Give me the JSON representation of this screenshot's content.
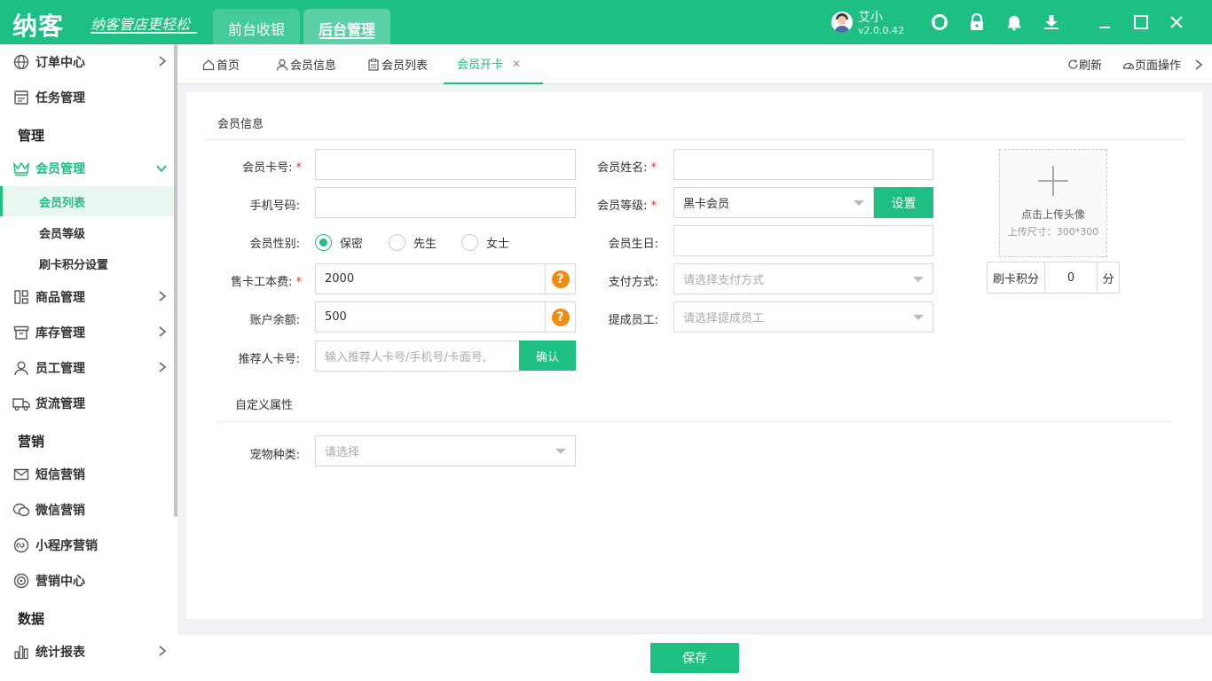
{
  "app": {
    "logo": "纳客",
    "slogan": "纳客管店更轻松",
    "nav": [
      "前台收银",
      "后台管理"
    ],
    "user_name": "艾小",
    "version": "v2.0.0.42",
    "accent_color": "#1dbf83"
  },
  "sidebar": {
    "items": [
      {
        "label": "订单中心",
        "icon": "globe-icon"
      },
      {
        "label": "任务管理",
        "icon": "task-icon"
      },
      {
        "label": "会员管理",
        "icon": "crown-icon"
      },
      {
        "label": "商品管理",
        "icon": "goods-icon"
      },
      {
        "label": "库存管理",
        "icon": "box-icon"
      },
      {
        "label": "员工管理",
        "icon": "user-icon"
      },
      {
        "label": "货流管理",
        "icon": "truck-icon"
      },
      {
        "label": "短信营销",
        "icon": "mail-icon"
      },
      {
        "label": "微信营销",
        "icon": "wechat-icon"
      },
      {
        "label": "小程序营销",
        "icon": "miniprogram-icon"
      },
      {
        "label": "营销中心",
        "icon": "target-icon"
      },
      {
        "label": "统计报表",
        "icon": "chart-icon"
      }
    ],
    "sections": [
      "管理",
      "营销",
      "数据"
    ],
    "sub_items": [
      "会员列表",
      "会员等级",
      "刷卡积分设置"
    ]
  },
  "tabs": {
    "items": [
      "首页",
      "会员信息",
      "会员列表",
      "会员开卡"
    ],
    "refresh": "刷新",
    "page_ops": "页面操作"
  },
  "form": {
    "section_member": "会员信息",
    "section_custom": "自定义属性",
    "labels": {
      "card_no": "会员卡号:",
      "name": "会员姓名:",
      "phone": "手机号码:",
      "level": "会员等级:",
      "gender": "会员性别:",
      "birthday": "会员生日:",
      "card_fee": "售卡工本费:",
      "payment": "支付方式:",
      "balance": "账户余额:",
      "commission": "提成员工:",
      "referrer": "推荐人卡号:",
      "pet": "宠物种类:"
    },
    "required_mark": "*",
    "level_value": "黑卡会员",
    "level_button": "设置",
    "gender_options": [
      "保密",
      "先生",
      "女士"
    ],
    "gender_selected": "保密",
    "card_fee_value": "2000",
    "balance_value": "500",
    "payment_placeholder": "请选择支付方式",
    "commission_placeholder": "请选择提成员工",
    "referrer_placeholder": "输入推荐人卡号/手机号/卡面号,",
    "referrer_button": "确认",
    "pet_placeholder": "请选择",
    "help_mark": "?",
    "upload_text": "点击上传头像",
    "upload_size": "上传尺寸：300*300",
    "points_label": "刷卡积分",
    "points_value": "0",
    "points_unit": "分"
  },
  "footer": {
    "save": "保存"
  }
}
